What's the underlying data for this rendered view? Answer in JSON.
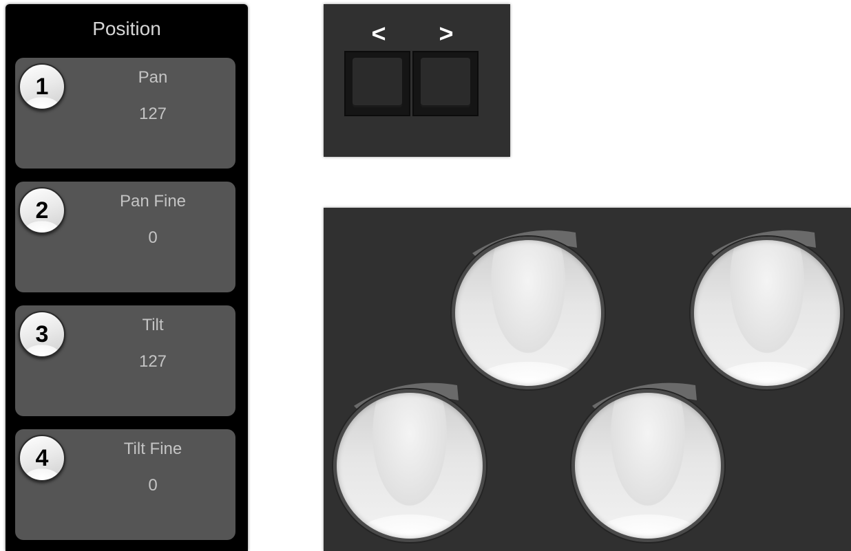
{
  "position_panel": {
    "title": "Position",
    "encoders": [
      {
        "number": "1",
        "name": "Pan",
        "value": "127"
      },
      {
        "number": "2",
        "name": "Pan Fine",
        "value": "0"
      },
      {
        "number": "3",
        "name": "Tilt",
        "value": "127"
      },
      {
        "number": "4",
        "name": "Tilt Fine",
        "value": "0"
      }
    ]
  },
  "page_nav": {
    "prev_label": "<",
    "next_label": ">"
  },
  "knobs": {
    "count": 4,
    "icon": "rotary-encoder-knob"
  },
  "colors": {
    "panel_bg": "#000000",
    "card_bg": "#555555",
    "box_bg": "#303030",
    "text": "#c4c4c4"
  }
}
